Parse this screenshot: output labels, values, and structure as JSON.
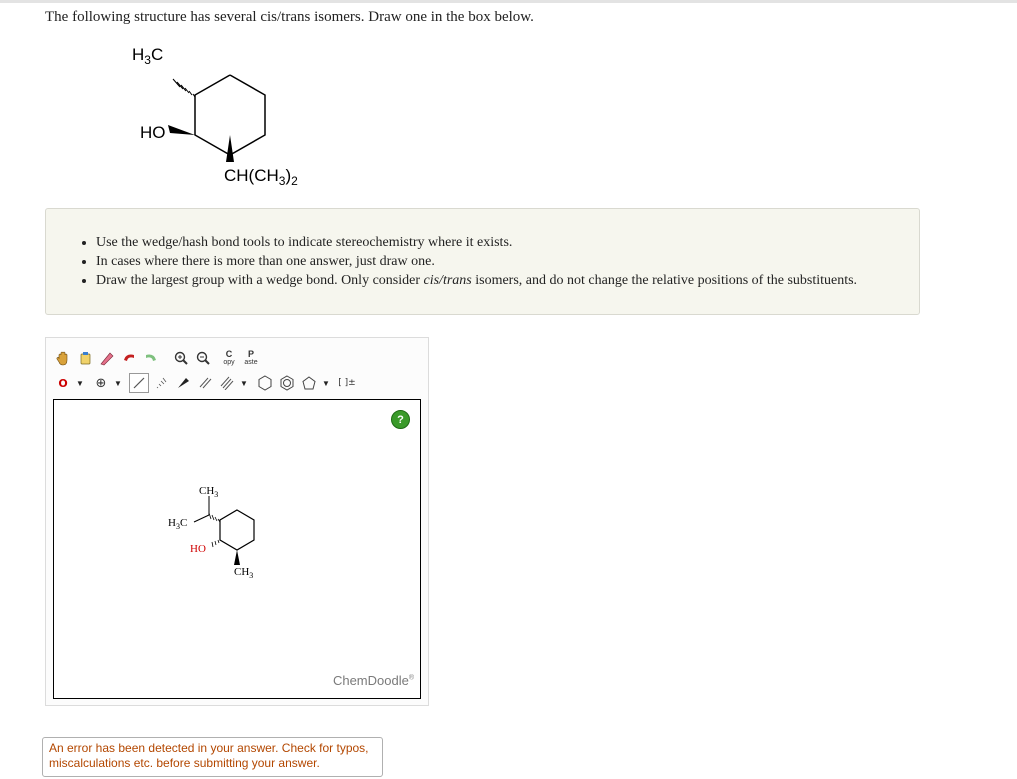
{
  "question": {
    "text": "The following structure has several cis/trans isomers. Draw one in the box below."
  },
  "structure": {
    "labels": {
      "methyl": "H3C",
      "hydroxyl": "HO",
      "isopropyl": "CH(CH3)2"
    }
  },
  "hints": {
    "items": [
      "Use the wedge/hash bond tools to indicate stereochemistry where it exists.",
      "In cases where there is more than one answer, just draw one.",
      "Draw the largest group with a wedge bond. Only consider ",
      "cis/trans",
      " isomers, and do not change the relative positions of the substituents."
    ]
  },
  "toolbar": {
    "row1": [
      {
        "name": "hand-icon",
        "glyph": "✋"
      },
      {
        "name": "lasso-icon",
        "glyph": "🗑"
      },
      {
        "name": "eraser-icon",
        "glyph": "✎"
      },
      {
        "name": "undo-icon",
        "glyph": "↶"
      },
      {
        "name": "redo-icon",
        "glyph": "↷"
      },
      {
        "name": "zoom-in-icon",
        "glyph": "⊕"
      },
      {
        "name": "zoom-out-icon",
        "glyph": "⊖"
      },
      {
        "name": "copy-icon",
        "top": "C",
        "bottom": "opy"
      },
      {
        "name": "paste-icon",
        "top": "P",
        "bottom": "aste"
      }
    ],
    "row2": {
      "atom_label": "O",
      "charge_label": "⊕",
      "bracket_label": "[ ]±"
    }
  },
  "canvas": {
    "help_label": "?",
    "brand": "ChemDoodle",
    "brand_mark": "®",
    "molecule_labels": {
      "top_methyl": "CH3",
      "left_methyl": "H3C",
      "hydroxyl": "HO",
      "bottom_methyl": "CH3"
    }
  },
  "error": {
    "message": "An error has been detected in your answer. Check for typos, miscalculations etc. before submitting your answer."
  }
}
